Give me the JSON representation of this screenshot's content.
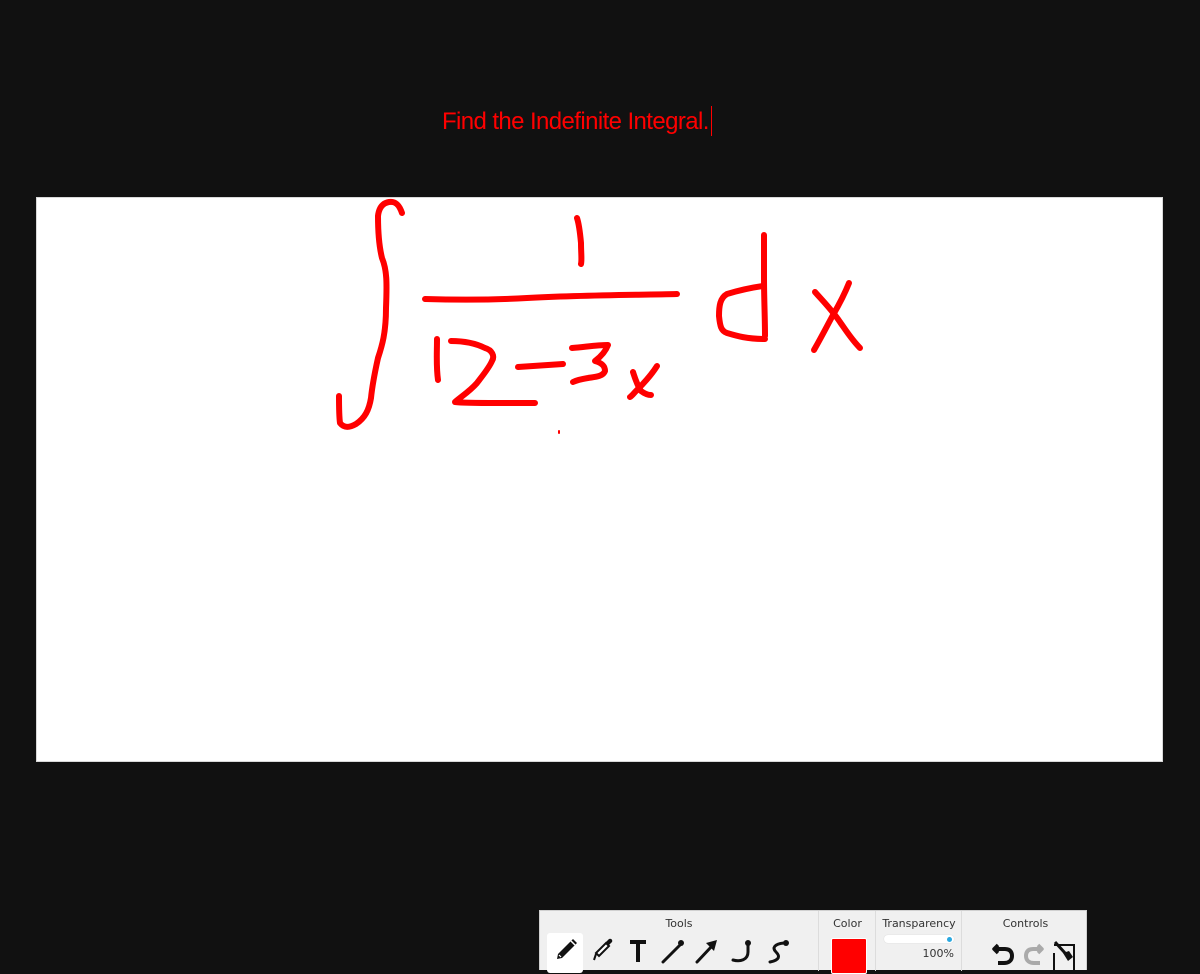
{
  "prompt": {
    "text": "Find the Indefinite Integral.",
    "color": "#ff0000"
  },
  "canvas": {
    "background": "#ffffff",
    "ink_color": "#ff0000",
    "handwritten_content": "∫ 1/(12 - 3x) dx",
    "strokes": [
      {
        "name": "integral-sign"
      },
      {
        "name": "numerator-one"
      },
      {
        "name": "fraction-bar"
      },
      {
        "name": "denominator-12"
      },
      {
        "name": "minus-sign"
      },
      {
        "name": "denominator-3x"
      },
      {
        "name": "dx"
      }
    ]
  },
  "toolbar": {
    "tools": {
      "label": "Tools",
      "items": [
        {
          "name": "pencil",
          "icon": "pencil-icon",
          "active": true
        },
        {
          "name": "marker",
          "icon": "marker-icon",
          "active": false
        },
        {
          "name": "text",
          "icon": "text-icon",
          "active": false
        },
        {
          "name": "line",
          "icon": "line-icon",
          "active": false
        },
        {
          "name": "arrow",
          "icon": "arrow-icon",
          "active": false
        },
        {
          "name": "curve",
          "icon": "curve-icon",
          "active": false
        },
        {
          "name": "bezier",
          "icon": "bezier-curve-icon",
          "active": false
        }
      ]
    },
    "color": {
      "label": "Color",
      "value": "#ff0000"
    },
    "transparency": {
      "label": "Transparency",
      "value_percent": 100,
      "value_text": "100%",
      "thumb_color": "#29a8e0"
    },
    "controls": {
      "label": "Controls",
      "items": [
        {
          "name": "undo",
          "icon": "undo-icon",
          "enabled": true
        },
        {
          "name": "redo",
          "icon": "redo-icon",
          "enabled": false
        },
        {
          "name": "clear",
          "icon": "clear-canvas-icon",
          "enabled": true
        }
      ]
    }
  }
}
